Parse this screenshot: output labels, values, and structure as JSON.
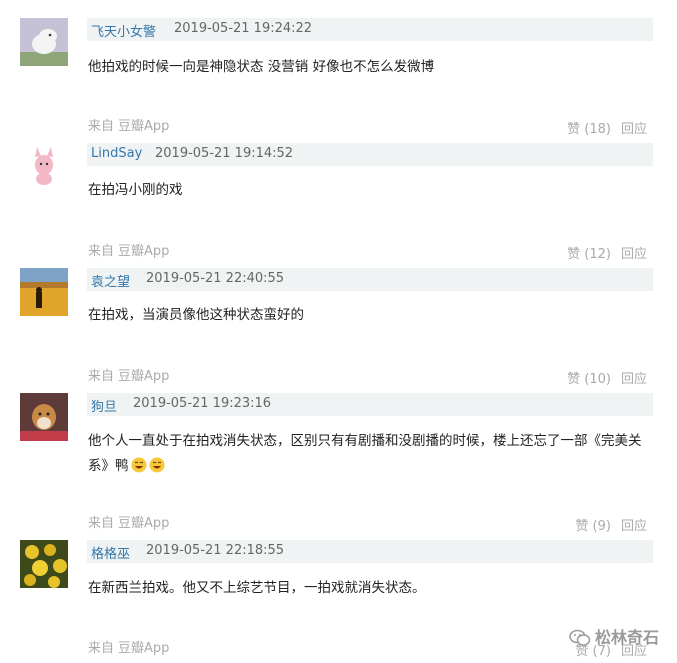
{
  "comments": [
    {
      "author": "飞天小女警",
      "time": "2019-05-21 19:24:22",
      "text": "他拍戏的时候一向是神隐状态 没营销 好像也不怎么发微博",
      "source_prefix": "来自",
      "source_app": "豆瓣App",
      "like_label": "赞 (18)",
      "reply_label": "回应"
    },
    {
      "author": "LindSay",
      "time": "2019-05-21 19:14:52",
      "text": "在拍冯小刚的戏",
      "source_prefix": "来自",
      "source_app": "豆瓣App",
      "like_label": "赞 (12)",
      "reply_label": "回应"
    },
    {
      "author": "袁之望",
      "time": "2019-05-21 22:40:55",
      "text": "在拍戏，当演员像他这种状态蛮好的",
      "source_prefix": "来自",
      "source_app": "豆瓣App",
      "like_label": "赞 (10)",
      "reply_label": "回应"
    },
    {
      "author": "狗旦",
      "time": "2019-05-21 19:23:16",
      "text": "他个人一直处于在拍戏消失状态，区别只有有剧播和没剧播的时候，楼上还忘了一部《完美关系》鸭",
      "source_prefix": "来自",
      "source_app": "豆瓣App",
      "like_label": "赞 (9)",
      "reply_label": "回应"
    },
    {
      "author": "格格巫",
      "time": "2019-05-21 22:18:55",
      "text": "在新西兰拍戏。他又不上综艺节目，一拍戏就消失状态。",
      "source_prefix": "来自",
      "source_app": "豆瓣App",
      "like_label": "赞 (7)",
      "reply_label": "回应"
    }
  ],
  "watermark": {
    "text": "松林奇石",
    "icon": "wechat-icon"
  },
  "colors": {
    "author": "#3377aa",
    "header_bg": "#f0f3f3",
    "muted": "#aaaaaa"
  }
}
